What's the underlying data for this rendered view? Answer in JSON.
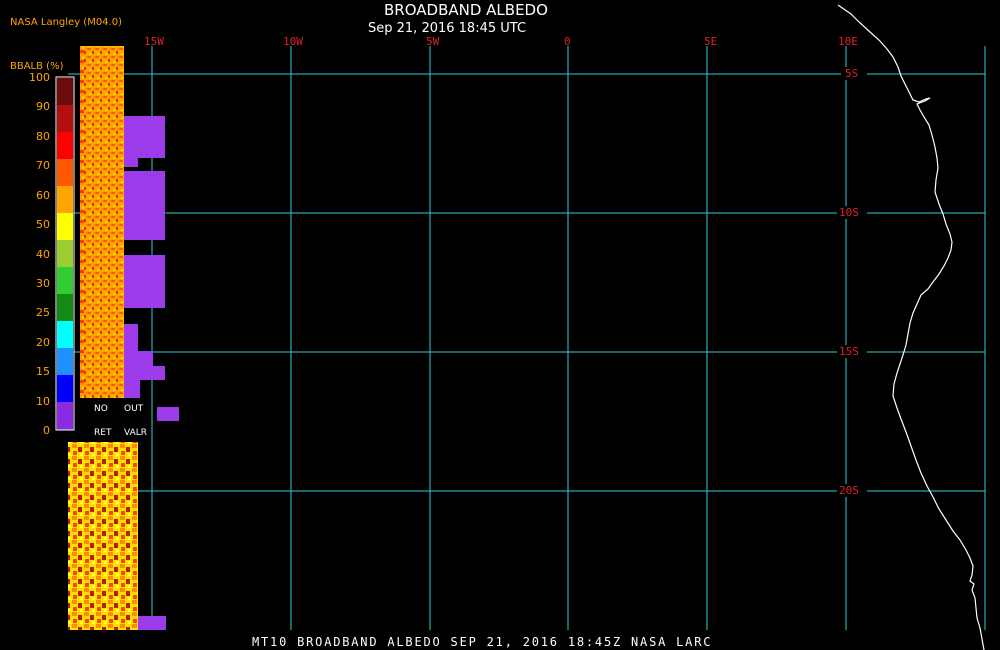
{
  "header": {
    "title": "BROADBAND ALBEDO",
    "subtitle": "Sep 21, 2016 18:45 UTC",
    "producer": "NASA Langley (M04.0)"
  },
  "footer": {
    "caption": "MT10  BROADBAND ALBEDO  SEP 21, 2016 18:45Z  NASA LARC"
  },
  "longitude_labels": [
    "15W",
    "10W",
    "5W",
    "0",
    "5E",
    "10E"
  ],
  "latitude_labels": [
    "5S",
    "10S",
    "15S",
    "20S"
  ],
  "colorbar": {
    "title": "BBALB (%)",
    "ticks": [
      "100",
      "90",
      "80",
      "70",
      "60",
      "50",
      "40",
      "30",
      "25",
      "20",
      "15",
      "10",
      "0"
    ],
    "colors": [
      "#6b0d0d",
      "#b30f0f",
      "#ff0000",
      "#ff5a00",
      "#ffa500",
      "#ffff00",
      "#9acd32",
      "#32cd32",
      "#138a13",
      "#00ffff",
      "#1e90ff",
      "#0000ff",
      "#8a2be2"
    ],
    "no_retrieval_label_1": "NO",
    "no_retrieval_label_2": "RET",
    "out_of_range_label_1": "OUT",
    "out_of_range_label_2": "VALR"
  },
  "colors": {
    "grid": "#2ecfd6",
    "coastline": "#ffffff",
    "axis_labels": "#e0202a",
    "no_retrieval": "#9b3bea",
    "accent": "#ffa500"
  }
}
